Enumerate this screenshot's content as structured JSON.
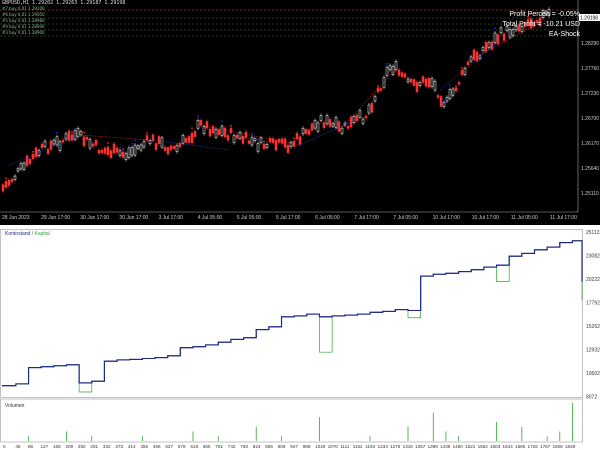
{
  "price_chart": {
    "ohlc_line": "GBPUSD,H1  1.29202 1.29263 1.29187 1.29198",
    "level_labels": [
      "#7 buy 0.01 1.29100",
      "#6 buy 0.01 1.29050",
      "#5 buy 0.01 1.28980",
      "#4 buy 0.01 1.28940",
      "#3 buy 0.01 1.28900"
    ],
    "info": {
      "profit_percent": "Profit Percen = -0.05%",
      "total_profit": "Total Profit = -10.21 USD",
      "ea_name": "EA-Shock"
    },
    "current_price": "1.29198",
    "price_ticks": [
      "1.28820",
      "1.28290",
      "1.27760",
      "1.27230",
      "1.26700",
      "1.26170",
      "1.25640",
      "1.25110"
    ],
    "time_ticks": [
      "28 Jun 2023",
      "29 Jun 17:00",
      "30 Jun 17:00",
      "30 Jun 17:00",
      "3 Jul 17:00",
      "4 Jul 05:00",
      "5 Jul 05:00",
      "5 Jul 17:00",
      "6 Jul 05:00",
      "7 Jul 17:00",
      "7 Jul 05:00",
      "10 Jul 17:00",
      "10 Jul 17:00",
      "11 Jul 05:00",
      "11 Jul 17:00"
    ],
    "colors": {
      "bull": "#ffffff",
      "bear": "#ff3030",
      "trade_up": "#2020ff",
      "trade_down": "#ff2020",
      "levels": "#4a7a4a"
    }
  },
  "balance_chart": {
    "legend": {
      "balance": "Kontostand",
      "separator": " / ",
      "equity": "Kapital"
    },
    "volume_label": "Volumen",
    "y_ticks": [
      "25113",
      "23082",
      "20222",
      "17792",
      "15262",
      "12932",
      "10502",
      "8072"
    ],
    "x_ticks": [
      "0",
      "45",
      "86",
      "127",
      "168",
      "209",
      "250",
      "291",
      "332",
      "373",
      "414",
      "455",
      "496",
      "537",
      "578",
      "619",
      "660",
      "701",
      "742",
      "783",
      "824",
      "865",
      "906",
      "947",
      "988",
      "1029",
      "1070",
      "1111",
      "1152",
      "1193",
      "1234",
      "1275",
      "1316",
      "1357",
      "1398",
      "1439",
      "1480",
      "1521",
      "1562",
      "1603",
      "1644",
      "1685",
      "1726",
      "1767",
      "1808",
      "1849"
    ],
    "colors": {
      "balance": "#1e2a8a",
      "equity": "#2ea82e"
    }
  },
  "chart_data": {
    "type": "line",
    "title": "",
    "xlabel": "",
    "ylabel": "",
    "x": [
      0,
      45,
      86,
      127,
      168,
      209,
      250,
      291,
      332,
      373,
      414,
      455,
      496,
      537,
      578,
      619,
      660,
      701,
      742,
      783,
      824,
      865,
      906,
      947,
      988,
      1029,
      1070,
      1111,
      1152,
      1193,
      1234,
      1275,
      1316,
      1357,
      1398,
      1439,
      1480,
      1521,
      1562,
      1603,
      1644,
      1685,
      1726,
      1767,
      1808,
      1849,
      1880
    ],
    "series": [
      {
        "name": "Kontostand",
        "values": [
          9100,
          9300,
          11100,
          11200,
          11300,
          11400,
          9400,
          9600,
          11800,
          11950,
          12000,
          12100,
          12200,
          12400,
          13300,
          13400,
          13600,
          13900,
          14200,
          14400,
          15300,
          15600,
          16700,
          16800,
          17000,
          16700,
          16800,
          16900,
          17000,
          17200,
          17300,
          17500,
          17400,
          21200,
          21400,
          21500,
          21700,
          21900,
          22200,
          22400,
          23400,
          23700,
          24100,
          24400,
          24900,
          25100,
          20600
        ]
      },
      {
        "name": "Kapital",
        "values": [
          9100,
          9300,
          11100,
          11200,
          11300,
          11400,
          8400,
          9600,
          11800,
          11950,
          12000,
          12100,
          12200,
          12400,
          13300,
          13400,
          13600,
          13900,
          14200,
          14400,
          15300,
          15600,
          16700,
          16800,
          17000,
          12800,
          16800,
          16900,
          17000,
          17200,
          17300,
          17500,
          16600,
          21200,
          21400,
          21500,
          21700,
          21900,
          22200,
          20600,
          23400,
          23700,
          24100,
          24400,
          24900,
          25100,
          18500
        ]
      }
    ],
    "ylim": [
      8072,
      25513
    ],
    "volume": [
      0,
      0,
      1,
      0,
      0,
      2,
      0,
      1,
      0,
      0,
      0,
      1,
      0,
      0,
      0,
      2,
      0,
      1,
      0,
      0,
      3,
      0,
      1,
      0,
      0,
      5,
      0,
      0,
      0,
      1,
      0,
      0,
      3,
      0,
      6,
      2,
      1,
      0,
      0,
      4,
      0,
      3,
      0,
      1,
      2,
      8,
      0
    ]
  }
}
